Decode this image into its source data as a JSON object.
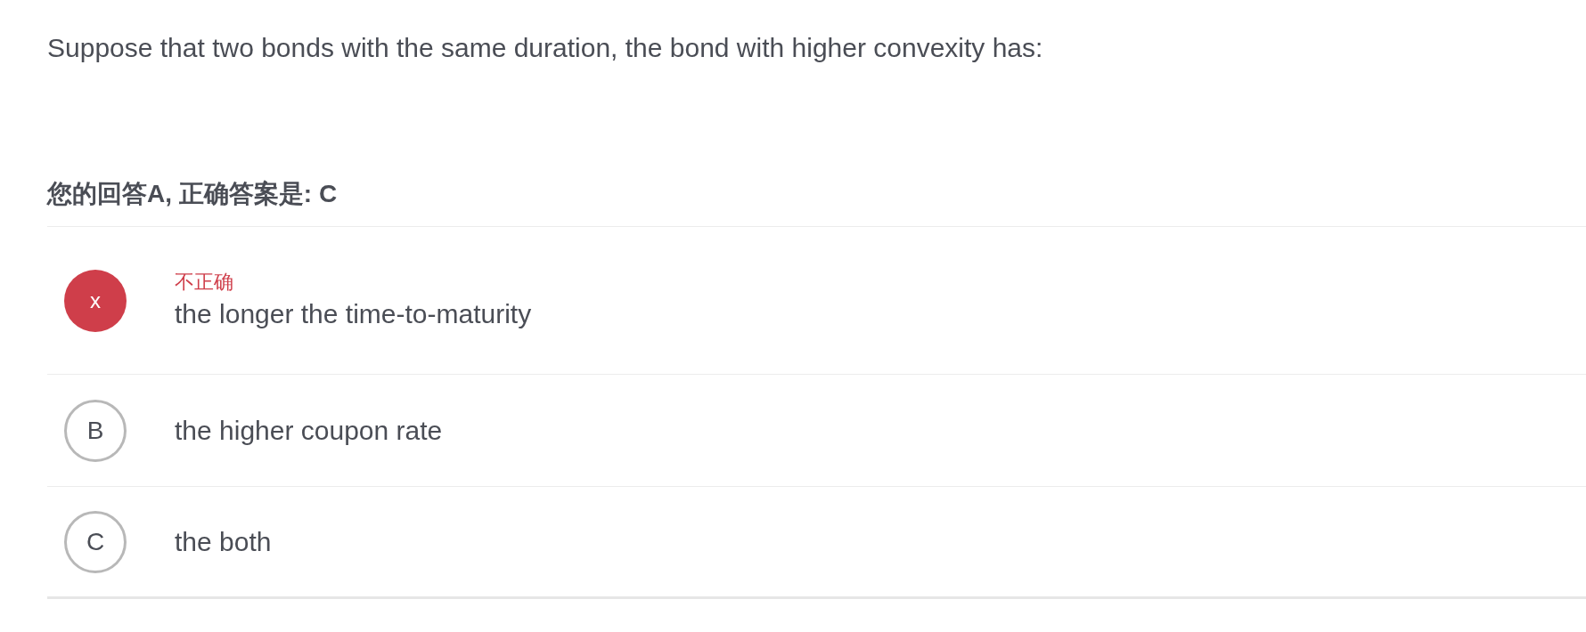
{
  "question": "Suppose that two bonds with the same duration, the bond with higher convexity has:",
  "result": "您的回答A, 正确答案是: C",
  "options": [
    {
      "kind": "wrong",
      "marker": "x",
      "feedback": "不正确",
      "text": "the longer the time-to-maturity"
    },
    {
      "kind": "plain",
      "marker": "B",
      "text": "the higher coupon rate"
    },
    {
      "kind": "plain",
      "marker": "C",
      "text": "the both"
    }
  ]
}
